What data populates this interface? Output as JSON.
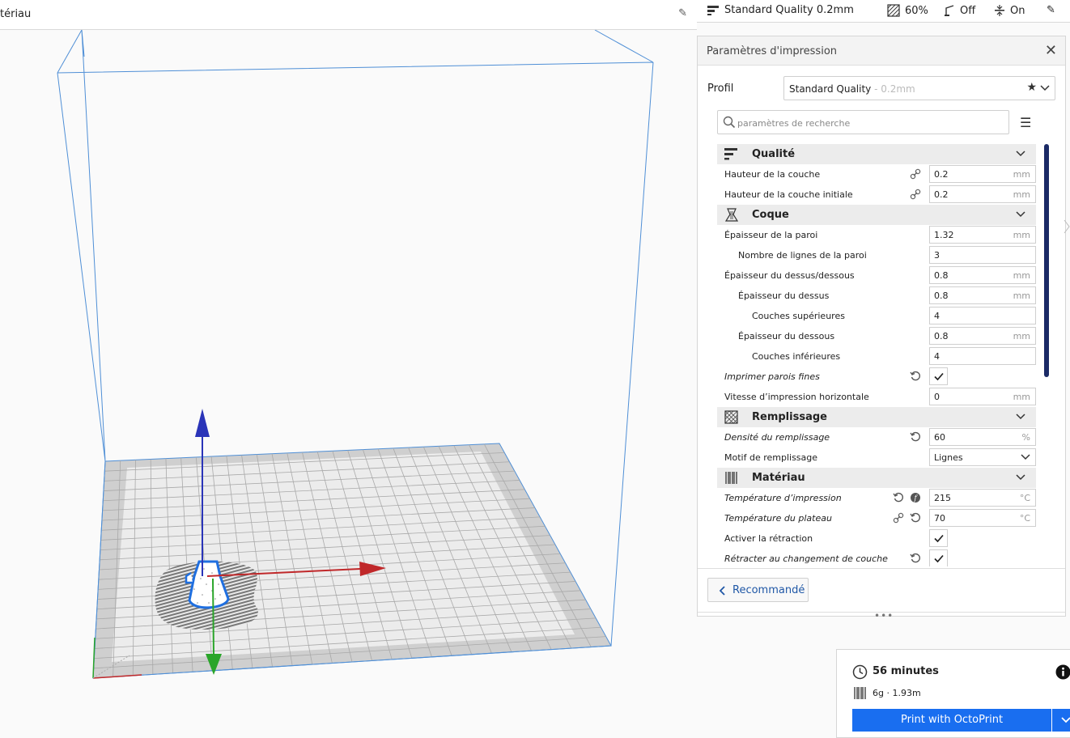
{
  "topbar": {
    "material_title": "tériau",
    "quality_label": "Standard Quality 0.2mm",
    "infill_label": "60%",
    "support_label": "Off",
    "adhesion_label": "On"
  },
  "panel": {
    "title": "Paramètres d'impression",
    "profile_label": "Profil",
    "profile_name": "Standard Quality",
    "profile_sub": " - 0.2mm",
    "search_placeholder": "paramètres de recherche",
    "recommended_label": "Recommandé"
  },
  "settings": {
    "cat_quality": "Qualité",
    "layer_height": {
      "label": "Hauteur de la couche",
      "value": "0.2",
      "unit": "mm"
    },
    "initial_layer_height": {
      "label": "Hauteur de la couche initiale",
      "value": "0.2",
      "unit": "mm"
    },
    "cat_shell": "Coque",
    "wall_thickness": {
      "label": "Épaisseur de la paroi",
      "value": "1.32",
      "unit": "mm"
    },
    "wall_line_count": {
      "label": "Nombre de lignes de la paroi",
      "value": "3"
    },
    "top_bottom_thickness": {
      "label": "Épaisseur du dessus/dessous",
      "value": "0.8",
      "unit": "mm"
    },
    "top_thickness": {
      "label": "Épaisseur du dessus",
      "value": "0.8",
      "unit": "mm"
    },
    "top_layers": {
      "label": "Couches supérieures",
      "value": "4"
    },
    "bottom_thickness": {
      "label": "Épaisseur du dessous",
      "value": "0.8",
      "unit": "mm"
    },
    "bottom_layers": {
      "label": "Couches inférieures",
      "value": "4"
    },
    "print_thin_walls": {
      "label": "Imprimer parois fines",
      "checked": true
    },
    "horizontal_speed": {
      "label": "Vitesse d’impression horizontale",
      "value": "0",
      "unit": "mm"
    },
    "cat_infill": "Remplissage",
    "infill_density": {
      "label": "Densité du remplissage",
      "value": "60",
      "unit": "%"
    },
    "infill_pattern": {
      "label": "Motif de remplissage",
      "value": "Lignes"
    },
    "cat_material": "Matériau",
    "print_temperature": {
      "label": "Température d’impression",
      "value": "215",
      "unit": "°C"
    },
    "bed_temperature": {
      "label": "Température du plateau",
      "value": "70",
      "unit": "°C"
    },
    "enable_retraction": {
      "label": "Activer la rétraction",
      "checked": true
    },
    "retract_layer_change": {
      "label": "Rétracter au changement de couche",
      "checked": true
    }
  },
  "print": {
    "time": "56 minutes",
    "filament": "6g · 1.93m",
    "button_label": "Print with OctoPrint"
  },
  "colors": {
    "accent": "#196ef0",
    "scrollbar": "#1b2a66",
    "axis_x": "#c0282a",
    "axis_y": "#2aa52a",
    "axis_z": "#2a34b8",
    "build_volume": "#4f8fd6"
  }
}
